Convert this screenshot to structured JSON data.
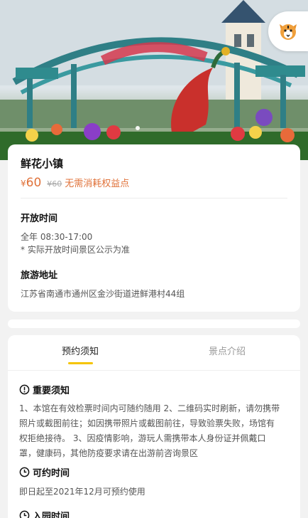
{
  "hero": {
    "dot_indicator": "1"
  },
  "logo": {
    "icon": "tiger-face-icon"
  },
  "place": {
    "title": "鲜花小镇",
    "price_currency": "¥",
    "price": "60",
    "original_price": "¥60",
    "no_consume": "无需消耗权益点"
  },
  "open_time": {
    "heading": "开放时间",
    "line1": "全年 08:30-17:00",
    "line2": "* 实际开放时间景区公示为准"
  },
  "address": {
    "heading": "旅游地址",
    "text": "江苏省南通市通州区金沙街道进鲜港村44组"
  },
  "tabs": [
    {
      "label": "预约须知",
      "active": true
    },
    {
      "label": "景点介绍",
      "active": false
    }
  ],
  "important": {
    "heading": "重要须知",
    "lines": [
      "1、本馆在有效检票时间内可随约随用 2、二维码实时刷新，请勿携带",
      "照片或截图前往；如因携带照片或截图前往，导致验票失败，场馆有",
      "权拒绝接待。 3、因疫情影响，游玩人需携带本人身份证并佩戴口",
      "罩，健康码，其他防疫要求请在出游前咨询景区"
    ]
  },
  "bookable": {
    "heading": "可约时间",
    "text": "即日起至2021年12月可预约使用"
  },
  "entry": {
    "heading": "入园时间"
  },
  "colors": {
    "accent": "#f5c400",
    "price": "#e0723a"
  }
}
